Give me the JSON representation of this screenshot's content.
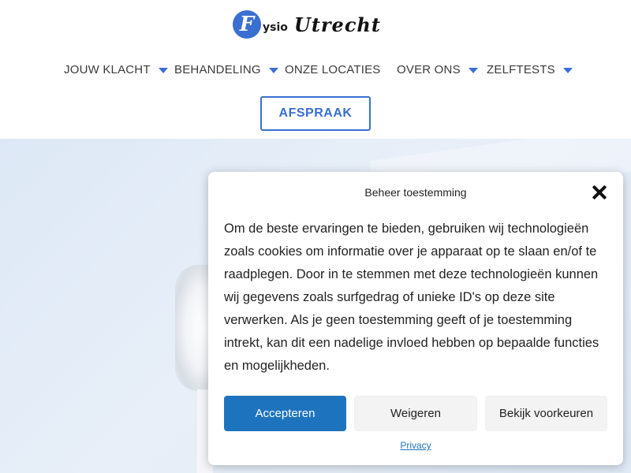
{
  "logo": {
    "letter": "F",
    "small": "ysio",
    "big": "Utrecht"
  },
  "nav": {
    "items": [
      {
        "label": "JOUW KLACHT",
        "has_dropdown": true
      },
      {
        "label": "BEHANDELING",
        "has_dropdown": true
      },
      {
        "label": "ONZE LOCATIES",
        "has_dropdown": false
      },
      {
        "label": "OVER ONS",
        "has_dropdown": true
      },
      {
        "label": "ZELFTESTS",
        "has_dropdown": true
      }
    ],
    "dropdown_icon": "caret-down-icon"
  },
  "cta": {
    "label": "AFSPRAAK"
  },
  "consent": {
    "title": "Beheer toestemming",
    "close_icon": "close-icon",
    "body": "Om de beste ervaringen te bieden, gebruiken wij technologieën zoals cookies om informatie over je apparaat op te slaan en/of te raadplegen. Door in te stemmen met deze technologieën kunnen wij gegevens zoals surfgedrag of unieke ID's op deze site verwerken. Als je geen toestemming geeft of je toestemming intrekt, kan dit een nadelige invloed hebben op bepaalde functies en mogelijkheden.",
    "accept_label": "Accepteren",
    "deny_label": "Weigeren",
    "preferences_label": "Bekijk voorkeuren",
    "privacy_label": "Privacy"
  },
  "colors": {
    "accent": "#3a6fd1",
    "accept_button": "#1e73be",
    "hero_bg": "#dde8f6"
  }
}
